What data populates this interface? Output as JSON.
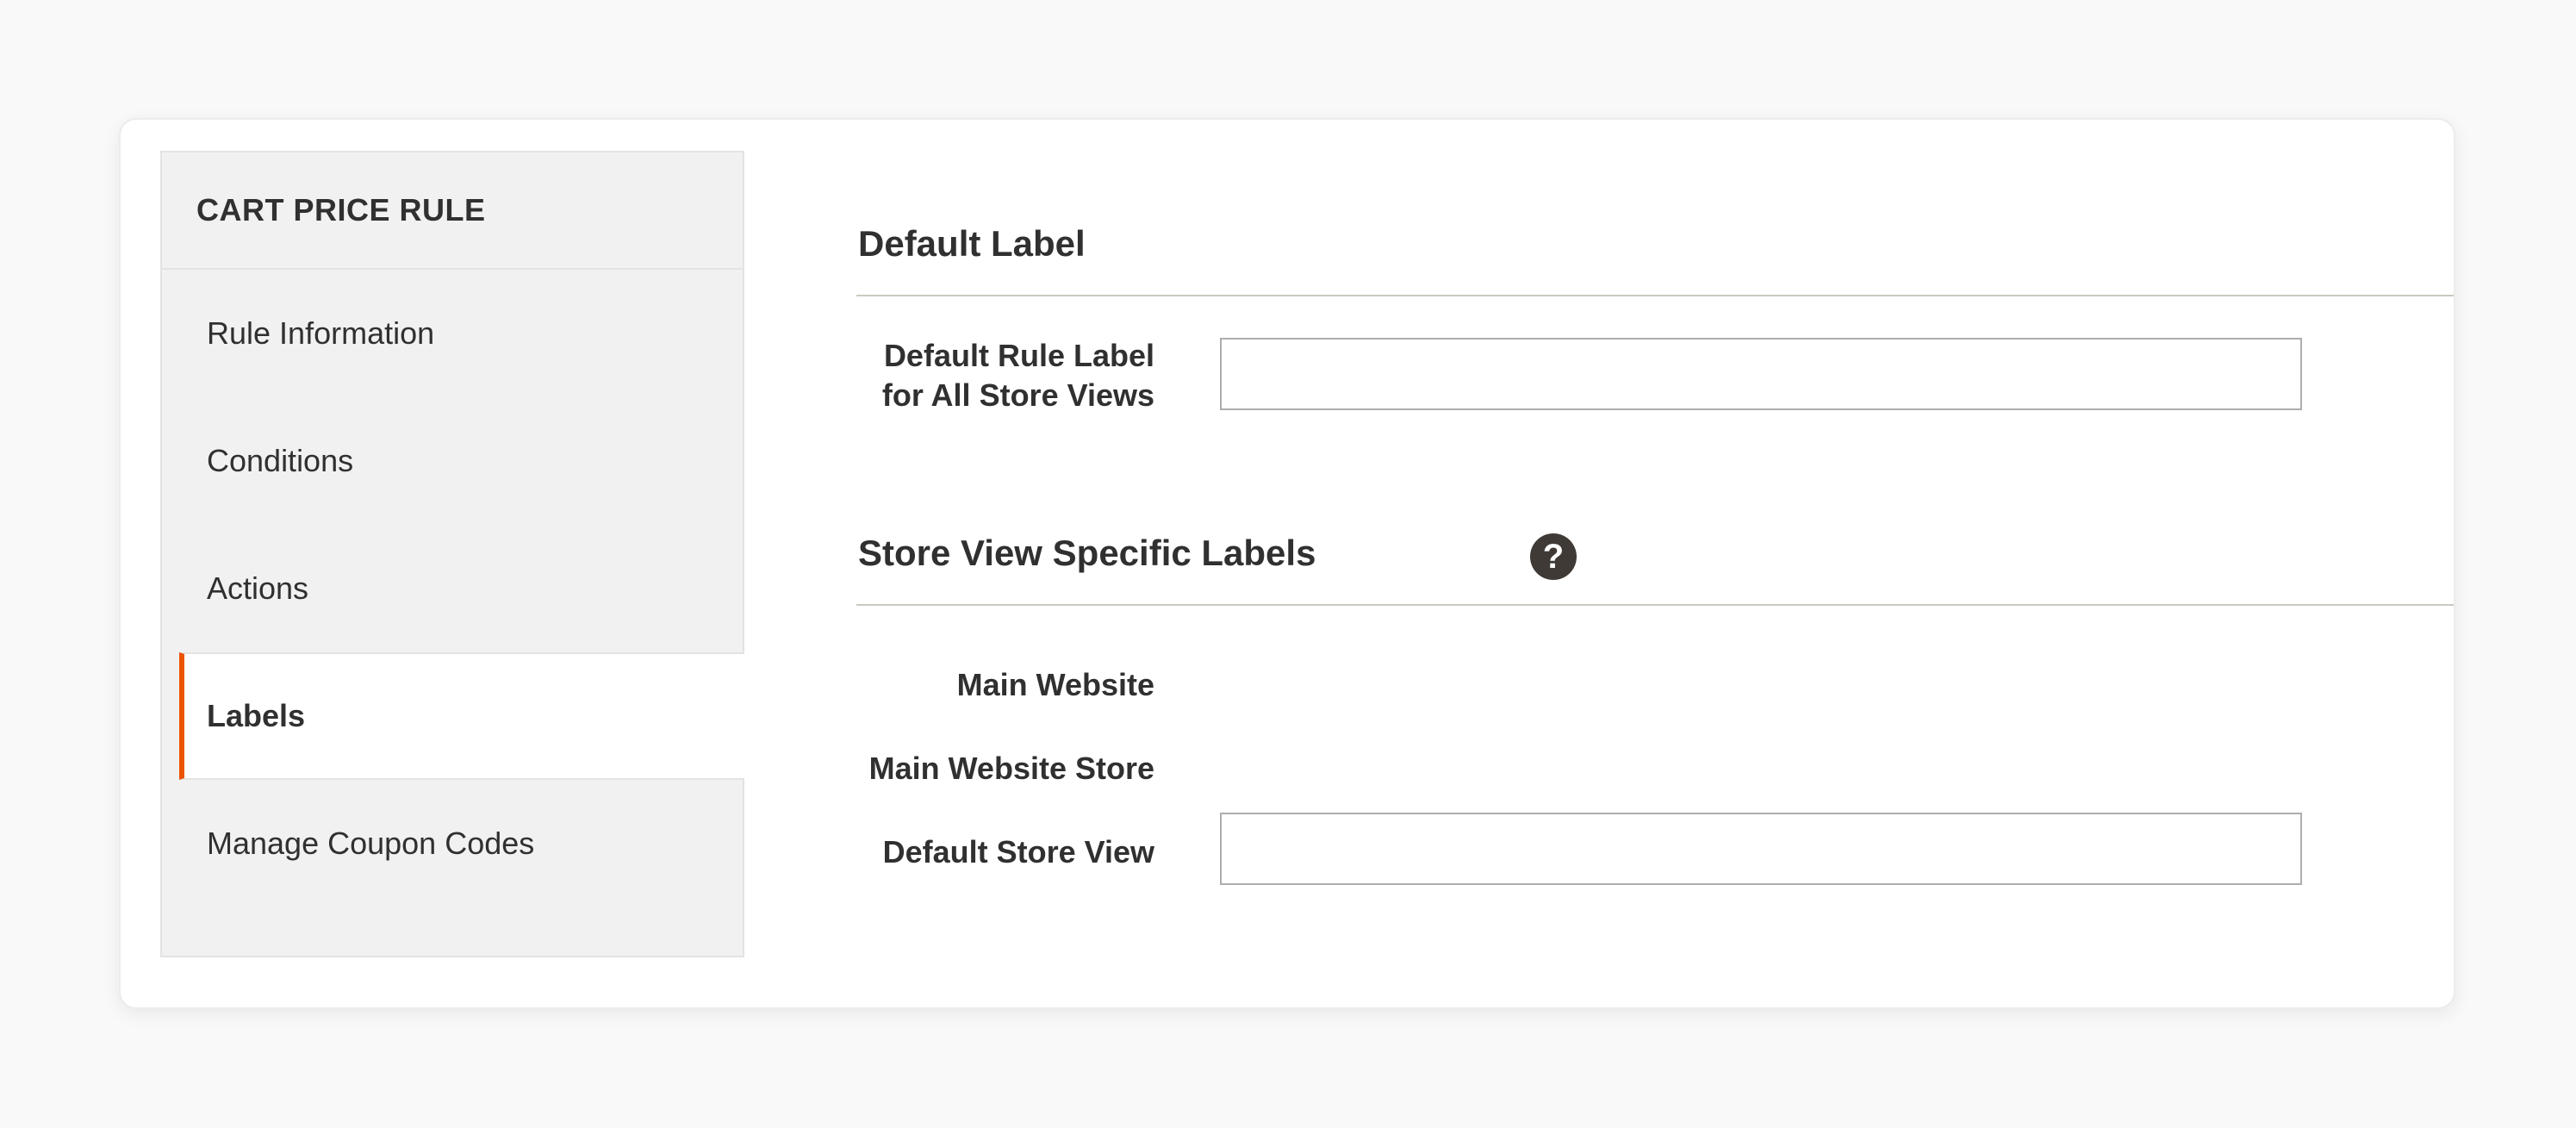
{
  "sidebar": {
    "title": "CART PRICE RULE",
    "items": [
      {
        "label": "Rule Information",
        "active": false
      },
      {
        "label": "Conditions",
        "active": false
      },
      {
        "label": "Actions",
        "active": false
      },
      {
        "label": "Labels",
        "active": true
      },
      {
        "label": "Manage Coupon Codes",
        "active": false
      }
    ]
  },
  "default_label": {
    "title": "Default Label",
    "field_label": "Default Rule Label for All Store Views",
    "field_label_lines": [
      "Default Rule Label",
      "for All Store Views"
    ],
    "value": ""
  },
  "store_view_labels": {
    "title": "Store View Specific Labels",
    "help_glyph": "?",
    "website": "Main Website",
    "store": "Main Website Store",
    "view_label": "Default Store View",
    "view_value": ""
  },
  "colors": {
    "accent": "#eb5202",
    "help_icon": "#3f3a35"
  }
}
